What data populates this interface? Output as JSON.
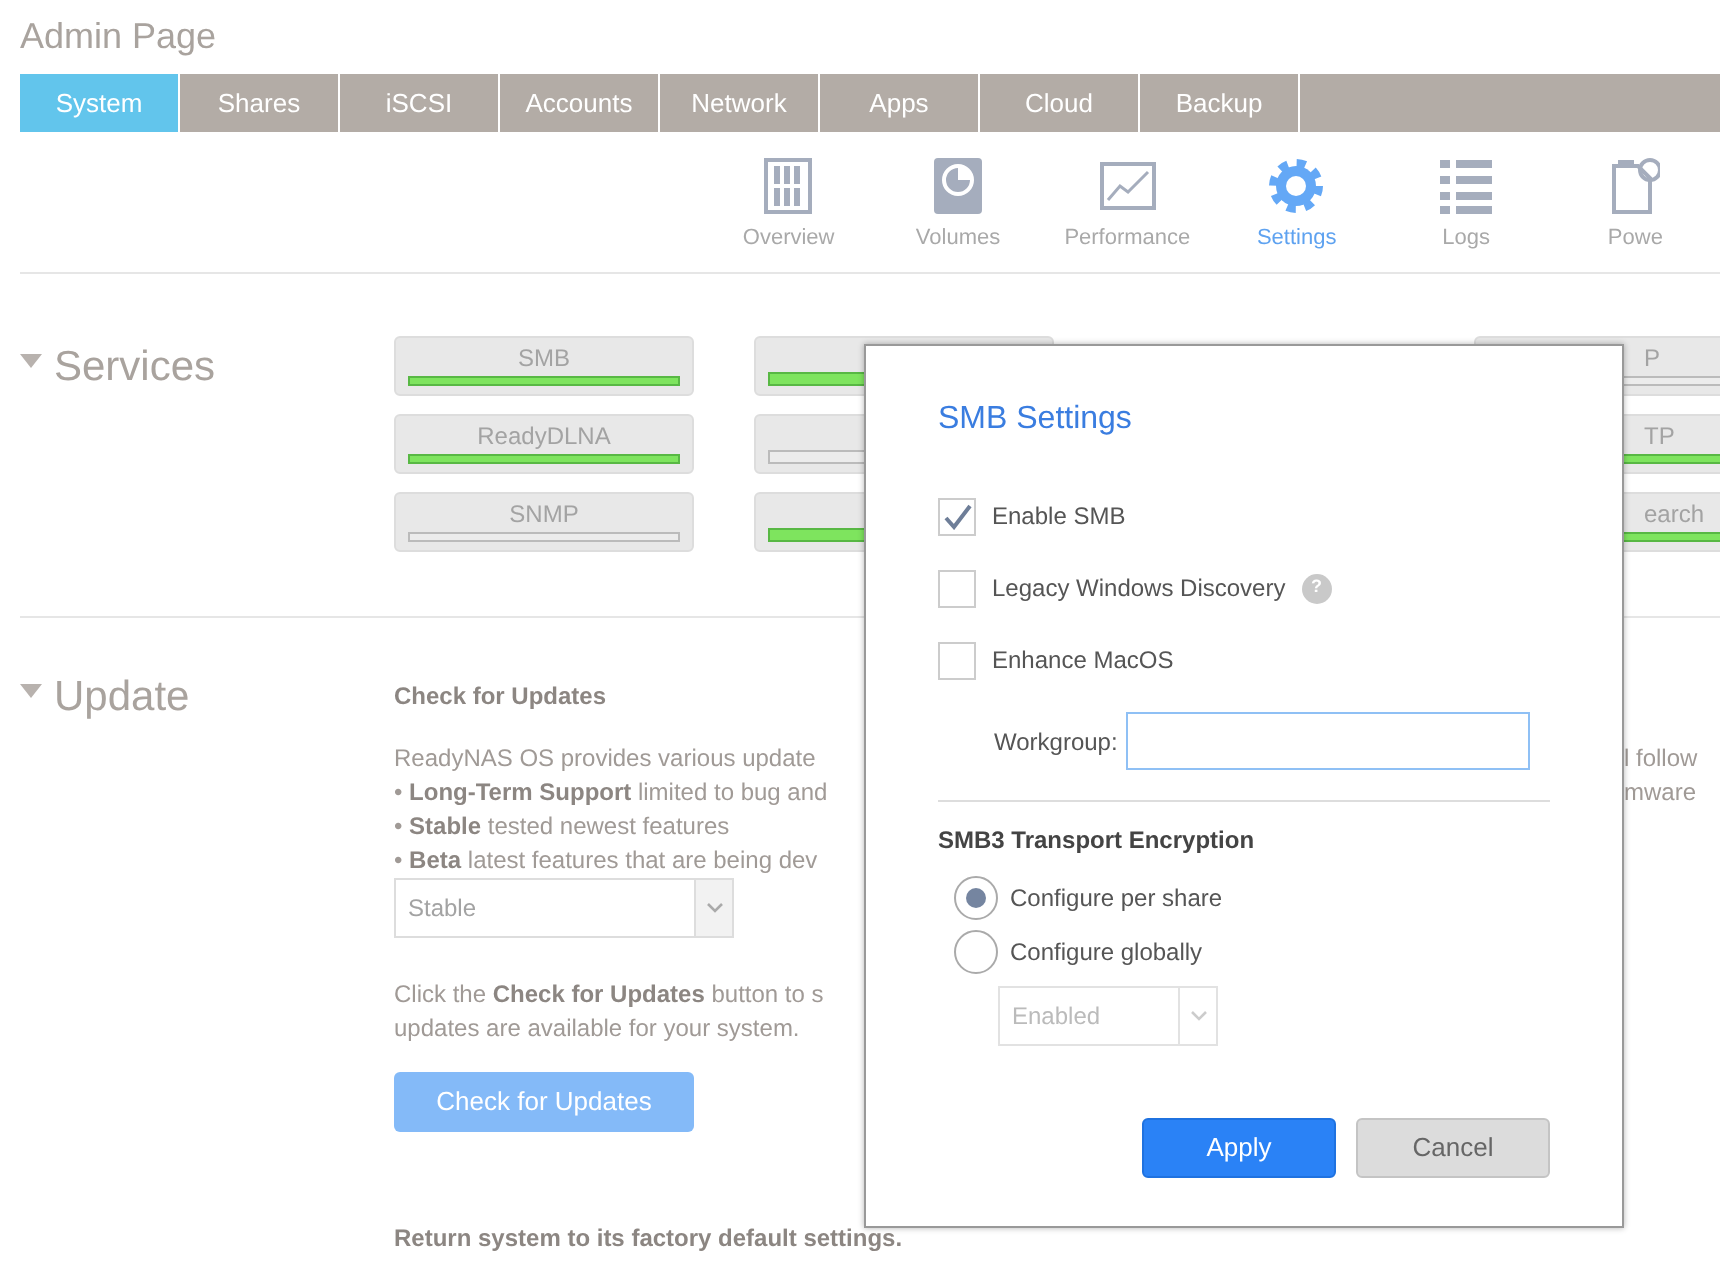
{
  "page_title": "Admin Page",
  "tabs": [
    {
      "label": "System",
      "selected": true
    },
    {
      "label": "Shares",
      "selected": false
    },
    {
      "label": "iSCSI",
      "selected": false
    },
    {
      "label": "Accounts",
      "selected": false
    },
    {
      "label": "Network",
      "selected": false
    },
    {
      "label": "Apps",
      "selected": false
    },
    {
      "label": "Cloud",
      "selected": false
    },
    {
      "label": "Backup",
      "selected": false
    }
  ],
  "subnav": [
    {
      "label": "Overview",
      "kind": "overview",
      "selected": false
    },
    {
      "label": "Volumes",
      "kind": "volumes",
      "selected": false
    },
    {
      "label": "Performance",
      "kind": "performance",
      "selected": false
    },
    {
      "label": "Settings",
      "kind": "settings",
      "selected": true
    },
    {
      "label": "Logs",
      "kind": "logs",
      "selected": false
    },
    {
      "label": "Powe",
      "kind": "power",
      "selected": false
    }
  ],
  "services": {
    "title": "Services",
    "expanded": true,
    "columns": [
      [
        {
          "label": "SMB",
          "on": true
        },
        {
          "label": "ReadyDLNA",
          "on": true
        },
        {
          "label": "SNMP",
          "on": false
        }
      ],
      [
        {
          "on": true
        },
        {
          "on": false
        },
        {
          "on": true
        }
      ],
      [
        {
          "label": "P",
          "on": false
        },
        {
          "label": "TP",
          "on": true
        },
        {
          "label": "earch",
          "on": true
        }
      ]
    ]
  },
  "update": {
    "title": "Update",
    "expanded": true,
    "heading": "Check for Updates",
    "lines": [
      {
        "text": "ReadyNAS OS provides various update",
        "fragment": "l follow"
      },
      {
        "text": "• **Long-Term Support** limited to bug and",
        "fragment": "mware"
      },
      {
        "text": "• **Stable** tested newest features"
      },
      {
        "text": "• **Beta** latest features that are being dev"
      }
    ],
    "channel_select": {
      "value": "Stable"
    },
    "hint_lines": [
      "Click the **Check for Updates** button to s",
      "updates are available for your system."
    ],
    "button": "Check for Updates",
    "footer": "Return system to its factory default settings."
  },
  "dialog": {
    "title": "SMB Settings",
    "options": [
      {
        "label": "Enable SMB",
        "checked": true
      },
      {
        "label": "Legacy Windows Discovery",
        "checked": false,
        "help": "?"
      },
      {
        "label": "Enhance MacOS",
        "checked": false
      }
    ],
    "workgroup": {
      "label": "Workgroup:",
      "focused": true
    },
    "encryption": {
      "title": "SMB3 Transport Encryption",
      "choices": [
        {
          "label": "Configure per share",
          "selected": true
        },
        {
          "label": "Configure globally",
          "selected": false
        }
      ],
      "select": {
        "value": "Enabled",
        "disabled": true
      }
    },
    "buttons": [
      {
        "label": "Apply",
        "kind": "primary"
      },
      {
        "label": "Cancel",
        "kind": "secondary"
      }
    ]
  }
}
